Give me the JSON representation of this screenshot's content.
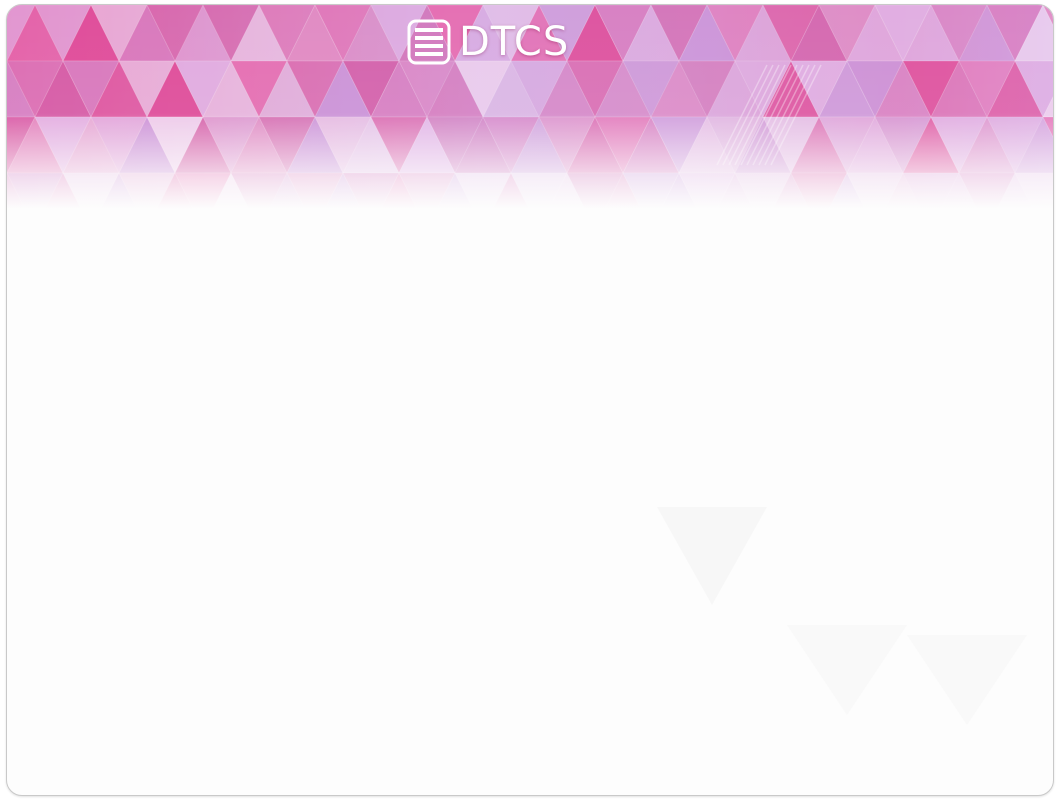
{
  "header": {
    "logo_text": "DTCS",
    "logo_icon": "document-list-icon"
  },
  "colors": {
    "accent_magenta": "#e0509a",
    "accent_lavender": "#c8a8e6",
    "text_on_banner": "#ffffff",
    "background": "#fdfdfd"
  }
}
